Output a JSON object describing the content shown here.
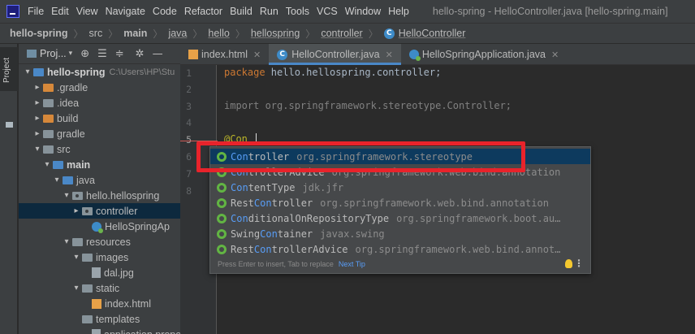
{
  "menubar": {
    "items": [
      "File",
      "Edit",
      "View",
      "Navigate",
      "Code",
      "Refactor",
      "Build",
      "Run",
      "Tools",
      "VCS",
      "Window",
      "Help"
    ],
    "title": "hello-spring - HelloController.java [hello-spring.main]"
  },
  "breadcrumb": [
    "hello-spring",
    "src",
    "main",
    "java",
    "hello",
    "hellospring",
    "controller",
    "HelloController"
  ],
  "project_panel": {
    "label": "Proj...",
    "tree": [
      {
        "label": "hello-spring",
        "hint": "C:\\Users\\HP\\Stu",
        "icon": "project-folder-icon",
        "arrow": "▾"
      },
      {
        "label": ".gradle",
        "icon": "folder-icon",
        "arrow": "▸"
      },
      {
        "label": ".idea",
        "icon": "folder-icon",
        "arrow": "▸"
      },
      {
        "label": "build",
        "icon": "folder-icon",
        "arrow": "▸"
      },
      {
        "label": "gradle",
        "icon": "folder-icon",
        "arrow": "▸"
      },
      {
        "label": "src",
        "icon": "folder-icon",
        "arrow": "▾"
      },
      {
        "label": "main",
        "icon": "folder-icon",
        "arrow": "▾"
      },
      {
        "label": "java",
        "icon": "folder-icon",
        "arrow": "▾"
      },
      {
        "label": "hello.hellospring",
        "icon": "package-icon",
        "arrow": "▾"
      },
      {
        "label": "controller",
        "icon": "package-icon",
        "arrow": "▸"
      },
      {
        "label": "HelloSpringAp",
        "icon": "spring-class-icon",
        "arrow": ""
      },
      {
        "label": "resources",
        "icon": "resources-folder-icon",
        "arrow": "▾"
      },
      {
        "label": "images",
        "icon": "folder-icon",
        "arrow": "▾"
      },
      {
        "label": "dal.jpg",
        "icon": "image-file-icon",
        "arrow": ""
      },
      {
        "label": "static",
        "icon": "folder-icon",
        "arrow": "▾"
      },
      {
        "label": "index.html",
        "icon": "html-file-icon",
        "arrow": ""
      },
      {
        "label": "templates",
        "icon": "folder-icon",
        "arrow": ""
      },
      {
        "label": "application.proper",
        "icon": "properties-file-icon",
        "arrow": ""
      }
    ]
  },
  "editor_tabs": [
    {
      "label": "index.html",
      "icon": "html-file-icon",
      "active": false
    },
    {
      "label": "HelloController.java",
      "icon": "class-icon",
      "active": true
    },
    {
      "label": "HelloSpringApplication.java",
      "icon": "spring-class-icon",
      "active": false
    }
  ],
  "gutter": {
    "lines": [
      "1",
      "2",
      "3",
      "4",
      "5",
      "6",
      "7",
      "8"
    ]
  },
  "code": {
    "line1_kw": "package",
    "line1_rest": " hello.hellospring.controller;",
    "line3_kw": "import",
    "line3_rest": " org.springframework.stereotype.Controller;",
    "line5": "@Con"
  },
  "completion": {
    "items": [
      {
        "pre": "",
        "match": "Con",
        "post": "troller",
        "pkg": "org.springframework.stereotype"
      },
      {
        "pre": "",
        "match": "Con",
        "post": "trollerAdvice",
        "pkg": "org.springframework.web.bind.annotation"
      },
      {
        "pre": "",
        "match": "Con",
        "post": "tentType",
        "pkg": "jdk.jfr"
      },
      {
        "pre": "Rest",
        "match": "Con",
        "post": "troller",
        "pkg": "org.springframework.web.bind.annotation"
      },
      {
        "pre": "",
        "match": "Con",
        "post": "ditionalOnRepositoryType",
        "pkg": "org.springframework.boot.au…"
      },
      {
        "pre": "Swing",
        "match": "Con",
        "post": "tainer",
        "pkg": "javax.swing"
      },
      {
        "pre": "Rest",
        "match": "Con",
        "post": "trollerAdvice",
        "pkg": "org.springframework.web.bind.annot…"
      }
    ],
    "footer_hint": "Press Enter to insert, Tab to replace",
    "footer_link": "Next Tip"
  },
  "sidebar_strip": {
    "label": "Project"
  },
  "colors": {
    "highlight_box": "#e8232b",
    "selection": "#0d3a5e",
    "accent": "#4a88c7"
  }
}
